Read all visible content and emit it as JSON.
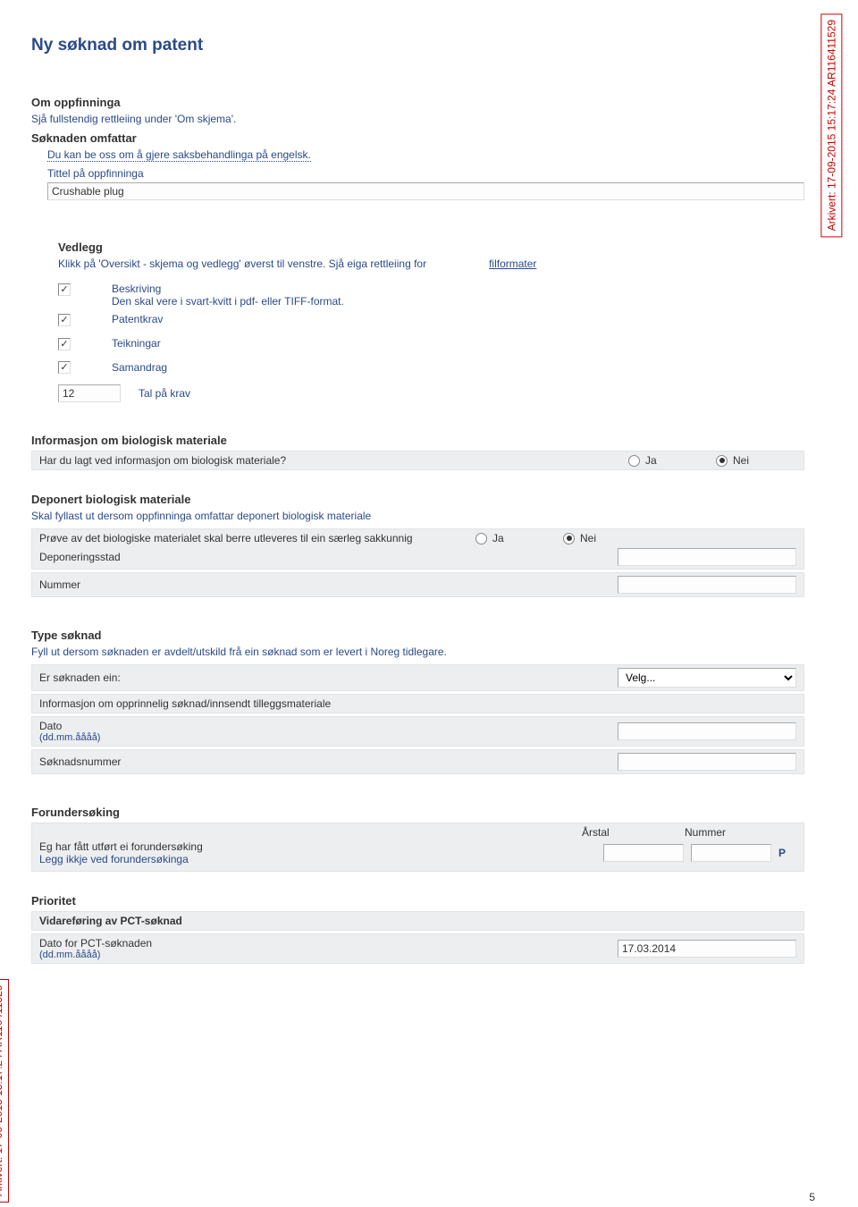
{
  "page_number": "5",
  "archive_stamp": "Arkivert: 17-09-2015 15:17:24 AR116411529",
  "title": "Ny søknad om patent",
  "om_oppfinninga": {
    "heading": "Om oppfinninga",
    "note": "Sjå fullstendig rettleiing under 'Om skjema'."
  },
  "soknaden_omfattar": {
    "heading": "Søknaden omfattar",
    "note": "Du kan be oss om å gjere saksbehandlinga på engelsk."
  },
  "tittel": {
    "label": "Tittel på oppfinninga",
    "value": "Crushable plug"
  },
  "vedlegg": {
    "heading": "Vedlegg",
    "intro": "Klikk på 'Oversikt - skjema og vedlegg' øverst til venstre. Sjå eiga rettleiing for",
    "link": "filformater",
    "items": [
      {
        "label": "Beskriving",
        "sub": "Den skal vere i svart-kvitt i pdf- eller TIFF-format.",
        "checked": true
      },
      {
        "label": "Patentkrav",
        "checked": true
      },
      {
        "label": "Teikningar",
        "checked": true
      },
      {
        "label": "Samandrag",
        "checked": true
      }
    ],
    "claims": {
      "value": "12",
      "label": "Tal på krav"
    }
  },
  "biomat": {
    "heading": "Informasjon om biologisk materiale",
    "q": "Har du lagt ved informasjon om biologisk materiale?",
    "ja": "Ja",
    "nei": "Nei",
    "sel": "nei"
  },
  "deponert": {
    "heading": "Deponert biologisk materiale",
    "note": "Skal fyllast ut dersom oppfinninga omfattar deponert biologisk materiale",
    "q": "Prøve av det biologiske materialet skal berre utleveres til ein særleg sakkunnig",
    "ja": "Ja",
    "nei": "Nei",
    "sel": "nei",
    "deponeringsstad_label": "Deponeringsstad",
    "nummer_label": "Nummer"
  },
  "type_soknad": {
    "heading": "Type søknad",
    "note": "Fyll ut dersom søknaden er avdelt/utskild frå ein søknad som er levert i Noreg tidlegare.",
    "er_label": "Er søknaden ein:",
    "select_value": "Velg...",
    "info_label": "Informasjon om opprinnelig søknad/innsendt tilleggsmateriale",
    "dato_label": "Dato",
    "dato_hint": "(dd.mm.åååå)",
    "soknadsnr_label": "Søknadsnummer"
  },
  "forundersoking": {
    "heading": "Forundersøking",
    "arstal": "Årstal",
    "nummer": "Nummer",
    "q": "Eg har fått utført ei forundersøking",
    "note": "Legg ikkje ved forundersøkinga",
    "p": "P"
  },
  "prioritet": {
    "heading": "Prioritet",
    "pct_heading": "Vidareføring av PCT-søknad",
    "dato_label": "Dato for PCT-søknaden",
    "dato_hint": "(dd.mm.åååå)",
    "dato_value": "17.03.2014"
  }
}
